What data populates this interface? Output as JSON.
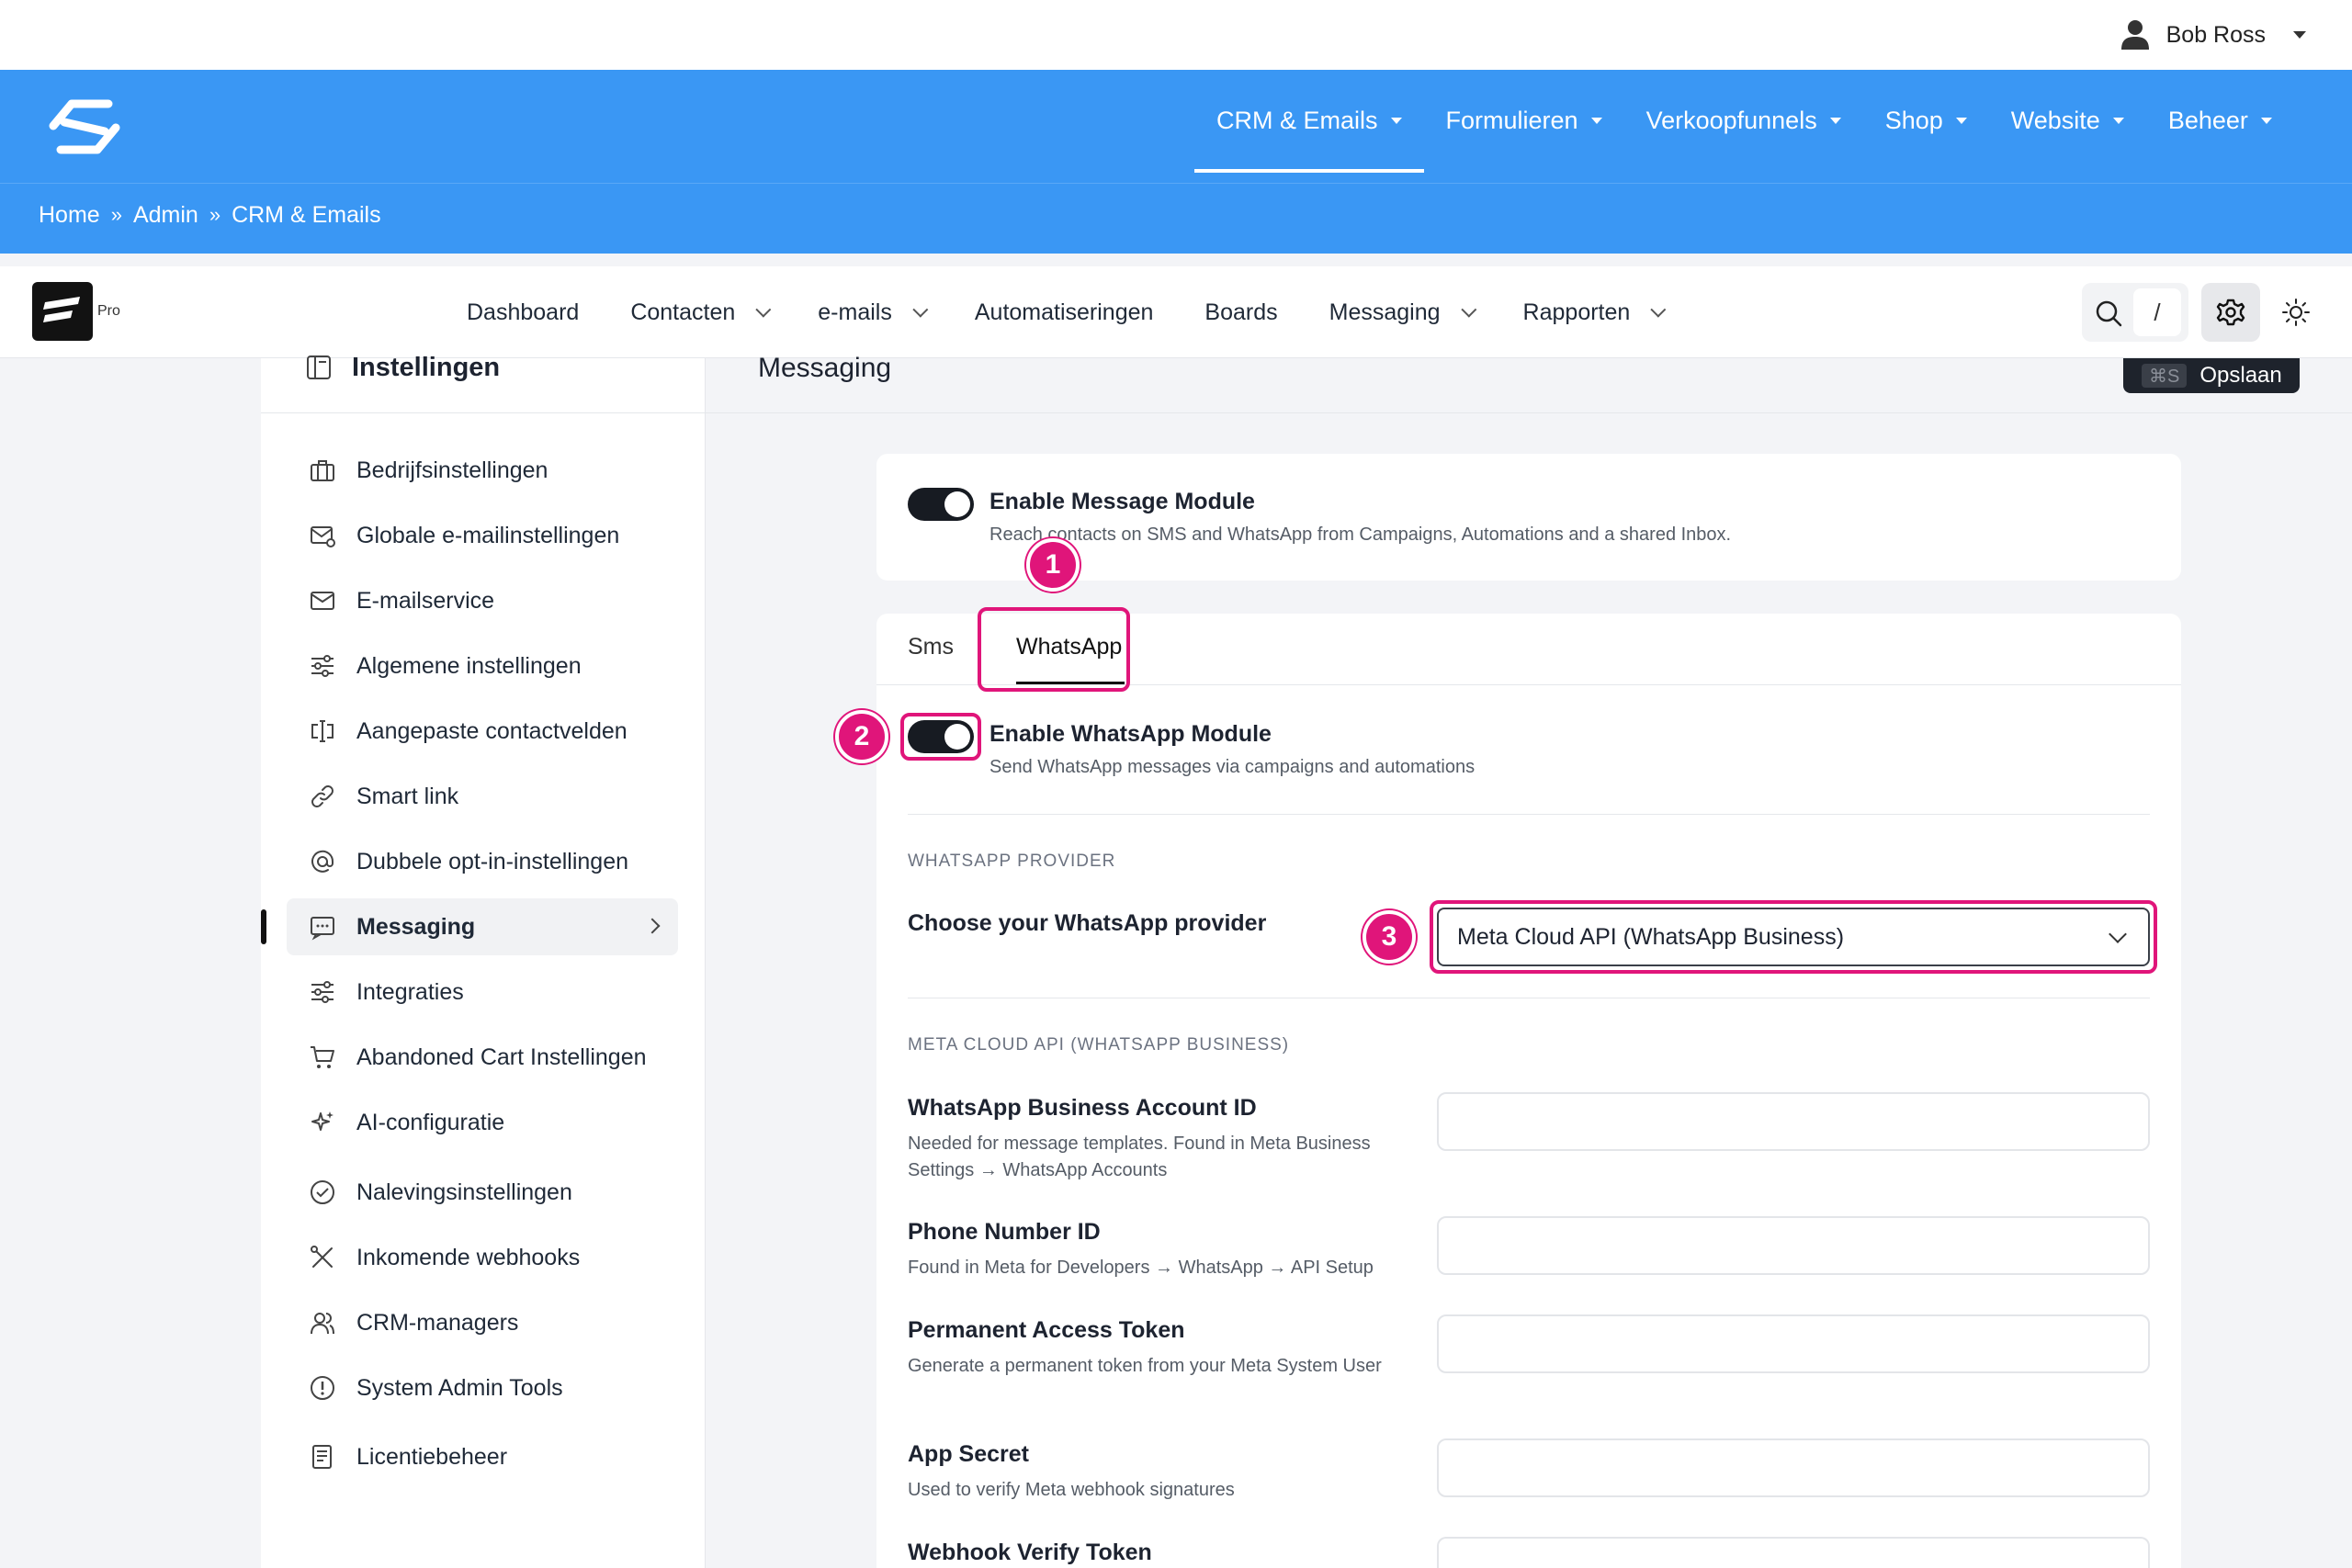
{
  "user": {
    "name": "Bob Ross"
  },
  "main_nav": {
    "items": [
      {
        "label": "CRM & Emails",
        "active": true
      },
      {
        "label": "Formulieren"
      },
      {
        "label": "Verkoopfunnels"
      },
      {
        "label": "Shop"
      },
      {
        "label": "Website"
      },
      {
        "label": "Beheer"
      }
    ]
  },
  "breadcrumb": {
    "items": [
      "Home",
      "Admin",
      "CRM & Emails"
    ],
    "separator": "»"
  },
  "app": {
    "badge": "Pro"
  },
  "app_nav": {
    "items": [
      "Dashboard",
      "Contacten",
      "e-mails",
      "Automatiseringen",
      "Boards",
      "Messaging",
      "Rapporten"
    ],
    "search_shortcut": "/"
  },
  "sidebar": {
    "title": "Instellingen",
    "items": [
      {
        "label": "Bedrijfsinstellingen",
        "icon": "briefcase-icon"
      },
      {
        "label": "Globale e-mailinstellingen",
        "icon": "mail-settings-icon"
      },
      {
        "label": "E-mailservice",
        "icon": "send-mail-icon"
      },
      {
        "label": "Algemene instellingen",
        "icon": "sliders-icon"
      },
      {
        "label": "Aangepaste contactvelden",
        "icon": "custom-fields-icon"
      },
      {
        "label": "Smart link",
        "icon": "link-icon"
      },
      {
        "label": "Dubbele opt-in-instellingen",
        "icon": "at-icon"
      },
      {
        "label": "Messaging",
        "icon": "message-icon",
        "active": true
      },
      {
        "label": "Integraties",
        "icon": "sliders-icon"
      },
      {
        "label": "Abandoned Cart Instellingen",
        "icon": "cart-icon"
      },
      {
        "label": "AI-configuratie",
        "icon": "sparkle-icon"
      },
      {
        "label": "Nalevingsinstellingen",
        "icon": "check-circle-icon"
      },
      {
        "label": "Inkomende webhooks",
        "icon": "tools-icon"
      },
      {
        "label": "CRM-managers",
        "icon": "users-icon"
      },
      {
        "label": "System Admin Tools",
        "icon": "alert-circle-icon"
      },
      {
        "label": "Licentiebeheer",
        "icon": "license-icon"
      }
    ]
  },
  "page": {
    "title": "Messaging",
    "save_shortcut": "⌘S",
    "save_label": "Opslaan"
  },
  "module": {
    "title": "Enable Message Module",
    "subtitle": "Reach contacts on SMS and WhatsApp from Campaigns, Automations and a shared Inbox.",
    "enabled": true
  },
  "tabs": {
    "sms": "Sms",
    "whatsapp": "WhatsApp",
    "active": "WhatsApp"
  },
  "whatsapp": {
    "toggle_title": "Enable WhatsApp Module",
    "toggle_subtitle": "Send WhatsApp messages via campaigns and automations",
    "enabled": true,
    "provider_section": "WHATSAPP PROVIDER",
    "provider_label": "Choose your WhatsApp provider",
    "provider_value": "Meta Cloud API (WhatsApp Business)",
    "meta_section": "META CLOUD API (WHATSAPP BUSINESS)",
    "fields": [
      {
        "label": "WhatsApp Business Account ID",
        "help": "Needed for message templates. Found in Meta Business Settings → WhatsApp Accounts",
        "value": ""
      },
      {
        "label": "Phone Number ID",
        "help": "Found in Meta for Developers → WhatsApp → API Setup",
        "value": ""
      },
      {
        "label": "Permanent Access Token",
        "help": "Generate a permanent token from your Meta System User",
        "value": ""
      },
      {
        "label": "App Secret",
        "help": "Used to verify Meta webhook signatures",
        "value": ""
      },
      {
        "label": "Webhook Verify Token",
        "help": "",
        "value": ""
      }
    ]
  },
  "annotations": [
    "1",
    "2",
    "3"
  ],
  "colors": {
    "header_blue": "#3a97f4",
    "highlight_pink": "#e0157a",
    "toggle_dark": "#171b22"
  }
}
